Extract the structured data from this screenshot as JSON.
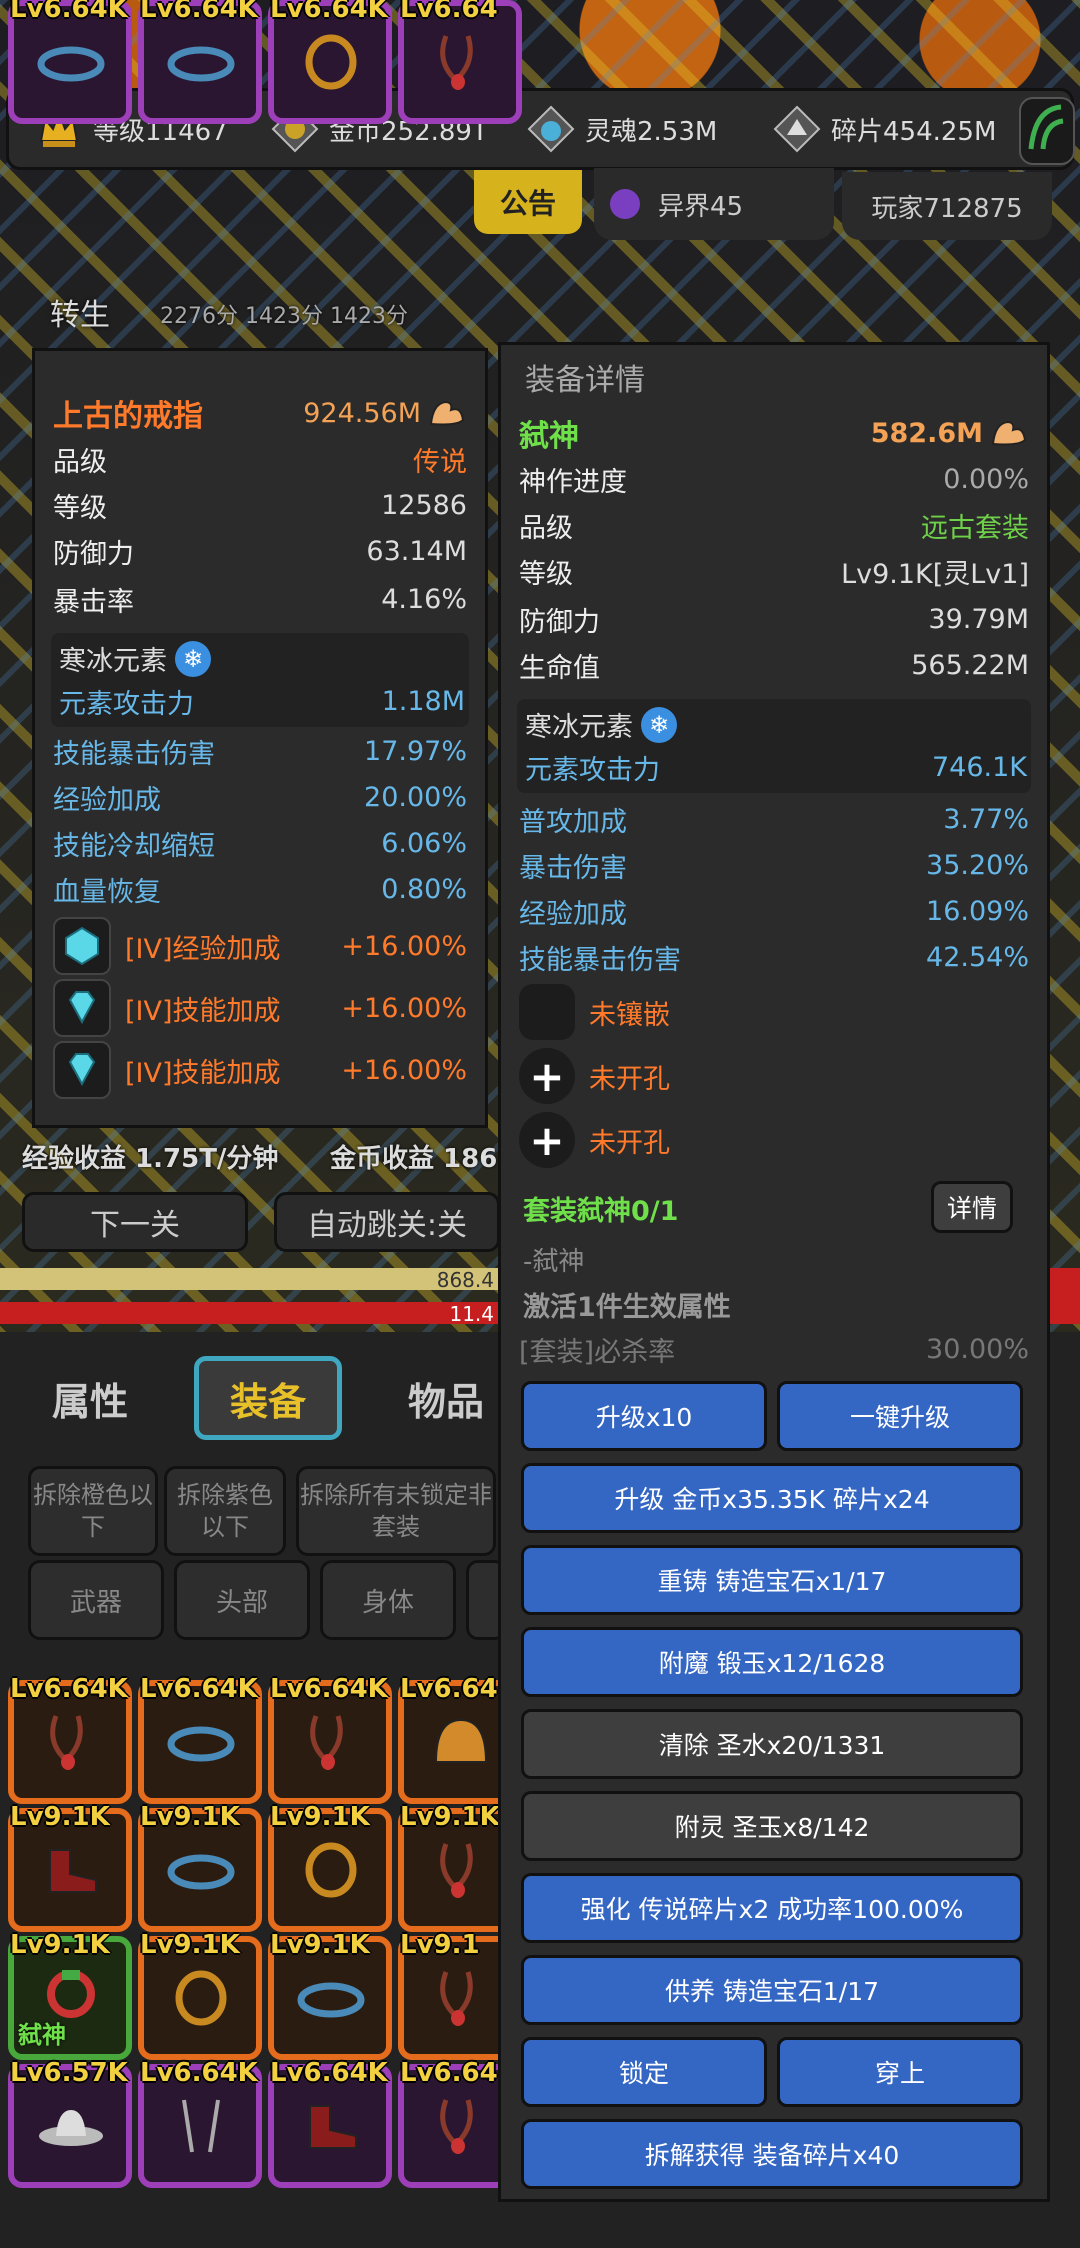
{
  "top_stats": [
    {
      "icon": "crown-icon",
      "label": "等级11467"
    },
    {
      "icon": "coin-icon",
      "label": "金币252.89T"
    },
    {
      "icon": "soul-icon",
      "label": "灵魂2.53M"
    },
    {
      "icon": "shard-icon",
      "label": "碎片454.25M"
    }
  ],
  "header": {
    "notice": "公告",
    "world": "异界45",
    "player": "玩家712875",
    "rebirth": "转生",
    "rebirth_scores": "2276分  1423分  1423分"
  },
  "left_panel": {
    "name": "上古的戒指",
    "power": "924.56M",
    "stats": [
      {
        "label": "品级",
        "value": "传说"
      },
      {
        "label": "等级",
        "value": "12586"
      },
      {
        "label": "防御力",
        "value": "63.14M"
      },
      {
        "label": "暴击率",
        "value": "4.16%"
      }
    ],
    "element": {
      "name": "寒冰元素",
      "attack_label": "元素攻击力",
      "attack_value": "1.18M"
    },
    "bonuses": [
      {
        "label": "技能暴击伤害",
        "value": "17.97%"
      },
      {
        "label": "经验加成",
        "value": "20.00%"
      },
      {
        "label": "技能冷却缩短",
        "value": "6.06%"
      },
      {
        "label": "血量恢复",
        "value": "0.80%"
      }
    ],
    "gems": [
      {
        "label": "[IV]经验加成",
        "value": "+16.00%",
        "glyph": "❂"
      },
      {
        "label": "[IV]技能加成",
        "value": "+16.00%",
        "glyph": ""
      },
      {
        "label": "[IV]技能加成",
        "value": "+16.00%",
        "glyph": ""
      }
    ]
  },
  "income": {
    "exp": "经验收益 1.75T/分钟",
    "gold": "金币收益 186"
  },
  "nav_buttons": {
    "next": "下一关",
    "auto": "自动跳关:关"
  },
  "bars": {
    "exp": "868.4",
    "hp": "11.4"
  },
  "right_panel": {
    "title": "装备详情",
    "name": "弑神",
    "power": "582.6M",
    "stats": [
      {
        "label": "神作进度",
        "value": "0.00%"
      },
      {
        "label": "品级",
        "value": "远古套装"
      },
      {
        "label": "等级",
        "value": "Lv9.1K[灵Lv1]"
      },
      {
        "label": "防御力",
        "value": "39.79M"
      },
      {
        "label": "生命值",
        "value": "565.22M"
      }
    ],
    "element": {
      "name": "寒冰元素",
      "attack_label": "元素攻击力",
      "attack_value": "746.1K"
    },
    "bonuses": [
      {
        "label": "普攻加成",
        "value": "3.77%"
      },
      {
        "label": "暴击伤害",
        "value": "35.20%"
      },
      {
        "label": "经验加成",
        "value": "16.09%"
      },
      {
        "label": "技能暴击伤害",
        "value": "42.54%"
      }
    ],
    "sockets": [
      {
        "label": "未镶嵌",
        "glyph": ""
      },
      {
        "label": "未开孔",
        "glyph": "+"
      },
      {
        "label": "未开孔",
        "glyph": "+"
      }
    ],
    "set": {
      "title": "套装弑神0/1",
      "detail_btn": "详情",
      "name": "-弑神",
      "activate": "激活1件生效属性",
      "attr_label": "[套装]必杀率",
      "attr_value": "30.00%"
    },
    "actions": {
      "upgrade10": "升级x10",
      "upgrade_all": "一键升级",
      "upgrade_cost": "升级 金币x35.35K 碎片x24",
      "recast": "重铸 铸造宝石x1/17",
      "enchant": "附魔 锻玉x12/1628",
      "clear": "清除 圣水x20/1331",
      "spirit": "附灵 圣玉x8/142",
      "strengthen": "强化 传说碎片x2 成功率100.00%",
      "offer": "供养 铸造宝石1/17",
      "lock": "锁定",
      "equip": "穿上",
      "dismantle": "拆解获得 装备碎片x40"
    }
  },
  "main_tabs": [
    "属性",
    "装备",
    "物品"
  ],
  "filters": [
    "拆除橙色以下",
    "拆除紫色以下",
    "拆除所有未锁定非套装"
  ],
  "categories": [
    "武器",
    "头部",
    "身体"
  ],
  "inventory": [
    {
      "lv": "Lv6.64K",
      "rarity": "orange",
      "icon": "amulet"
    },
    {
      "lv": "Lv6.64K",
      "rarity": "orange",
      "icon": "ring-blue"
    },
    {
      "lv": "Lv6.64K",
      "rarity": "orange",
      "icon": "amulet"
    },
    {
      "lv": "Lv6.64",
      "rarity": "orange",
      "icon": "helmet"
    },
    {
      "lv": "Lv9.1K",
      "rarity": "orange",
      "icon": "boot"
    },
    {
      "lv": "Lv9.1K",
      "rarity": "orange",
      "icon": "ring-blue"
    },
    {
      "lv": "Lv9.1K",
      "rarity": "orange",
      "icon": "ring-gold"
    },
    {
      "lv": "Lv9.1K",
      "rarity": "orange",
      "icon": "amulet"
    },
    {
      "lv": "Lv9.1K",
      "rarity": "green",
      "icon": "amulet-green",
      "tag": "弑神"
    },
    {
      "lv": "Lv9.1K",
      "rarity": "orange",
      "icon": "ring-gold"
    },
    {
      "lv": "Lv9.1K",
      "rarity": "orange",
      "icon": "ring-blue"
    },
    {
      "lv": "Lv9.1",
      "rarity": "orange",
      "icon": "amulet"
    },
    {
      "lv": "Lv6.57K",
      "rarity": "purple",
      "icon": "hat"
    },
    {
      "lv": "Lv6.64K",
      "rarity": "purple",
      "icon": "swords"
    },
    {
      "lv": "Lv6.64K",
      "rarity": "purple",
      "icon": "boot"
    },
    {
      "lv": "Lv6.64",
      "rarity": "purple",
      "icon": "amulet"
    },
    {
      "lv": "Lv6.64K",
      "rarity": "purple",
      "icon": "ring-blue"
    },
    {
      "lv": "Lv6.64K",
      "rarity": "purple",
      "icon": "ring-blue"
    },
    {
      "lv": "Lv6.64K",
      "rarity": "purple",
      "icon": "ring-gold"
    },
    {
      "lv": "Lv6.64",
      "rarity": "purple",
      "icon": "amulet"
    }
  ],
  "colors": {
    "accent_gold": "#d6b21c",
    "button_blue": "#3466c4",
    "legend_orange": "#ff7a2a",
    "set_green": "#6fe04a",
    "bonus_blue": "#67b8e8"
  }
}
